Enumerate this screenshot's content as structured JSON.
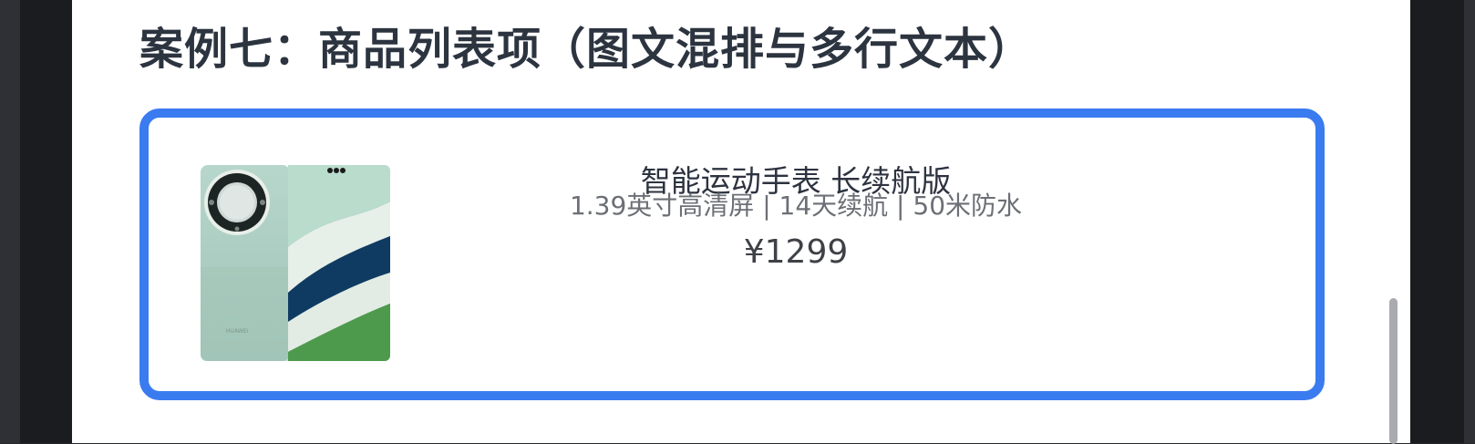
{
  "section": {
    "title": "案例七：商品列表项（图文混排与多行文本）"
  },
  "product": {
    "name": "智能运动手表 长续航版",
    "specs": "1.39英寸高清屏 | 14天续航 | 50米防水",
    "price": "¥1299",
    "image_icon": "phone-product-image",
    "brand_mark": "HUAWEI"
  },
  "colors": {
    "card_border": "#3a7bf0",
    "title_text": "#2c3440",
    "page_background": "#ffffff",
    "frame_background": "#1b1c1f"
  }
}
